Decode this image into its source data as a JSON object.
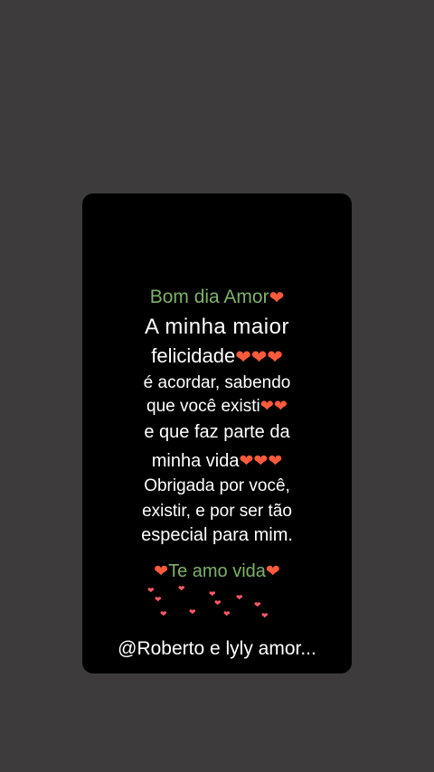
{
  "story": {
    "line1_text": "Bom dia Amor",
    "line2_text": "A  minha  maior",
    "line3_text": "felicidade",
    "line4_text": "é acordar, sabendo",
    "line5_text": "que você existi",
    "line6_text": "e que faz parte da",
    "line7_text": "minha vida",
    "line8_text": "Obrigada por você,",
    "line9_text": "existir, e por ser tão",
    "line10_text": "especial para mim.",
    "line11_text": "Te amo vida",
    "handle": "@Roberto e lyly amor..."
  },
  "icons": {
    "heart": "❤"
  },
  "colors": {
    "background": "#3d3b3c",
    "card": "#000000",
    "green_text": "#7fb069",
    "heart": "#ff5a3c"
  }
}
